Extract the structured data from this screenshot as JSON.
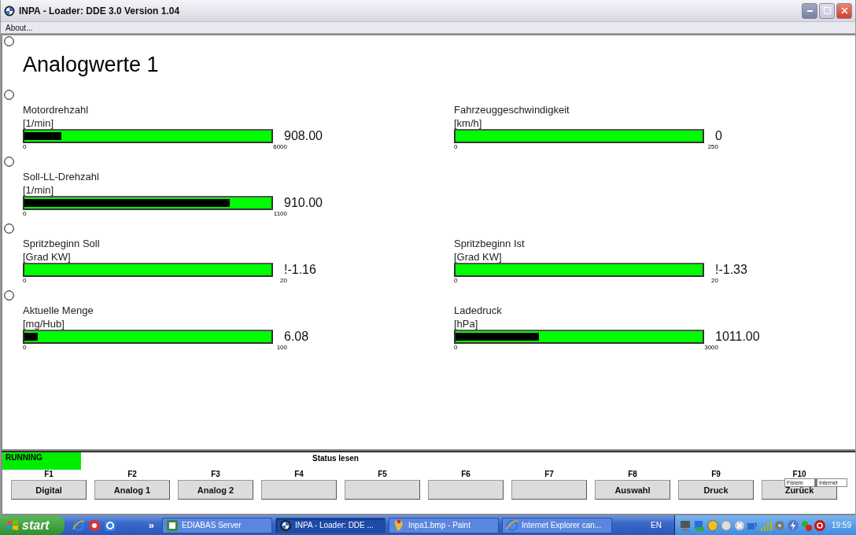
{
  "window": {
    "title": "INPA - Loader:  DDE 3.0 Version 1.04"
  },
  "menu": [
    "About..."
  ],
  "page": {
    "title": "Analogwerte 1",
    "rows": [
      [
        {
          "name": "Motordrehzahl",
          "unit": "[1/min]",
          "level": 0.15,
          "min": "0",
          "max": "6000",
          "reading": "908.00"
        },
        {
          "name": "Fahrzeuggeschwindigkeit",
          "unit": "[km/h]",
          "level": 0,
          "min": "0",
          "max": "250",
          "reading": "0"
        }
      ],
      [
        {
          "name": "Soll-LL-Drehzahl",
          "unit": "[1/min]",
          "level": 0.83,
          "min": "0",
          "max": "1100",
          "reading": "910.00"
        }
      ],
      [
        {
          "name": "Spritzbeginn Soll",
          "unit": "[Grad KW]",
          "level": 0,
          "min": "0",
          "max": "20",
          "reading": "!-1.16"
        },
        {
          "name": "Spritzbeginn Ist",
          "unit": "[Grad KW]",
          "level": 0,
          "min": "0",
          "max": "20",
          "reading": "!-1.33"
        }
      ],
      [
        {
          "name": "Aktuelle Menge",
          "unit": "[mg/Hub]",
          "level": 0.055,
          "min": "0",
          "max": "100",
          "reading": "6.08"
        },
        {
          "name": "Ladedruck",
          "unit": "[hPa]",
          "level": 0.337,
          "min": "0",
          "max": "3000",
          "reading": "1011.00"
        }
      ]
    ]
  },
  "status": {
    "state": "RUNNING",
    "title": "Status lesen"
  },
  "fkeys": [
    {
      "key": "F1",
      "label": "Digital"
    },
    {
      "key": "F2",
      "label": "Analog 1"
    },
    {
      "key": "F3",
      "label": "Analog 2"
    },
    {
      "key": "F4"
    },
    {
      "key": "F5"
    },
    {
      "key": "F6"
    },
    {
      "key": "F7"
    },
    {
      "key": "F8",
      "label": "Auswahl"
    },
    {
      "key": "F9",
      "label": "Druck"
    },
    {
      "key": "F10",
      "label": "Zurück"
    }
  ],
  "overlay": {
    "tabs": [
      "Fisiere",
      "Internet"
    ]
  },
  "taskbar": {
    "start": "start",
    "more": "»",
    "tasks": [
      {
        "label": "EDIABAS Server",
        "selected": false
      },
      {
        "label": "INPA - Loader:  DDE ...",
        "selected": true
      },
      {
        "label": "Inpa1.bmp - Paint",
        "selected": false
      },
      {
        "label": "Internet Explorer can...",
        "selected": false
      }
    ],
    "language": "EN",
    "clock": "19:59"
  }
}
